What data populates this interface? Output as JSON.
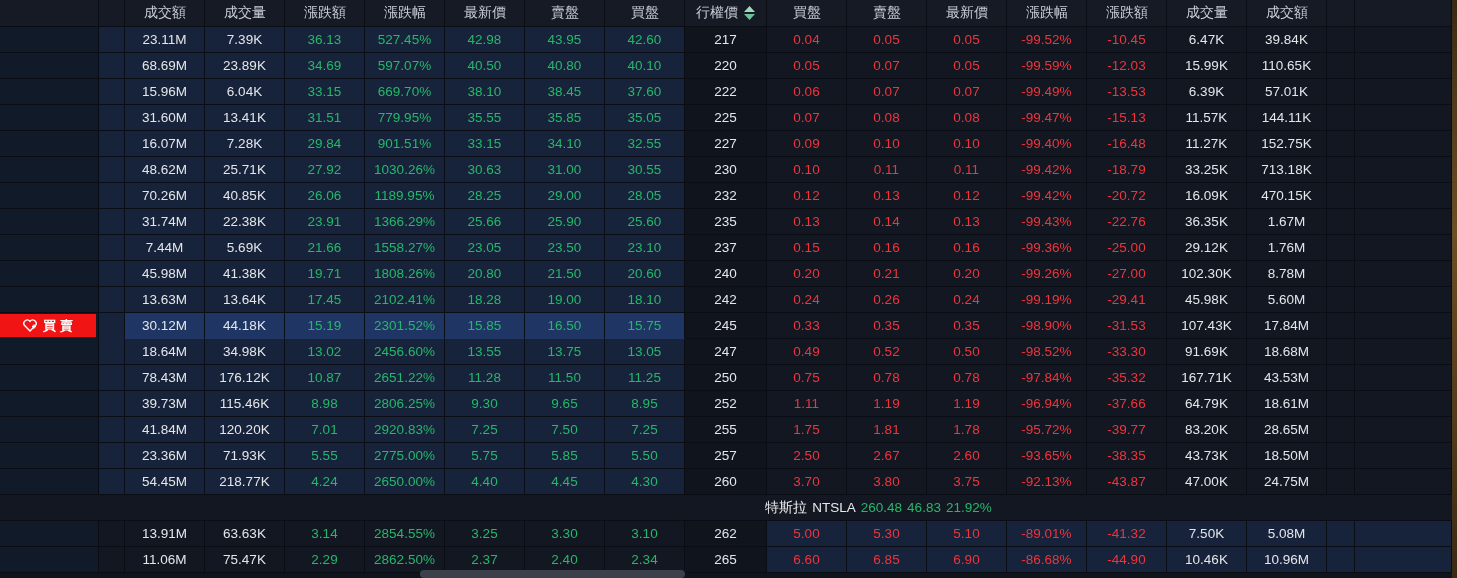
{
  "call_columns": [
    {
      "label": "成交額",
      "kind": "plain"
    },
    {
      "label": "成交量",
      "kind": "plain"
    },
    {
      "label": "漲跌額",
      "kind": "rise"
    },
    {
      "label": "漲跌幅",
      "kind": "rise"
    },
    {
      "label": "最新價",
      "kind": "rise"
    },
    {
      "label": "賣盤",
      "kind": "rise"
    },
    {
      "label": "買盤",
      "kind": "rise"
    }
  ],
  "strike_column": {
    "label": "行權價",
    "sorted": true
  },
  "put_columns": [
    {
      "label": "買盤",
      "kind": "fall"
    },
    {
      "label": "賣盤",
      "kind": "fall"
    },
    {
      "label": "最新價",
      "kind": "fall"
    },
    {
      "label": "漲跌幅",
      "kind": "fall"
    },
    {
      "label": "漲跌額",
      "kind": "fall"
    },
    {
      "label": "成交量",
      "kind": "plain"
    },
    {
      "label": "成交額",
      "kind": "plain"
    }
  ],
  "rows": [
    {
      "strike": "217",
      "selected": false,
      "call_itm": true,
      "put_itm": false,
      "call": [
        "23.11M",
        "7.39K",
        "36.13",
        "527.45%",
        "42.98",
        "43.95",
        "42.60"
      ],
      "put": [
        "0.04",
        "0.05",
        "0.05",
        "-99.52%",
        "-10.45",
        "6.47K",
        "39.84K"
      ]
    },
    {
      "strike": "220",
      "selected": false,
      "call_itm": true,
      "put_itm": false,
      "call": [
        "68.69M",
        "23.89K",
        "34.69",
        "597.07%",
        "40.50",
        "40.80",
        "40.10"
      ],
      "put": [
        "0.05",
        "0.07",
        "0.05",
        "-99.59%",
        "-12.03",
        "15.99K",
        "110.65K"
      ]
    },
    {
      "strike": "222",
      "selected": false,
      "call_itm": true,
      "put_itm": false,
      "call": [
        "15.96M",
        "6.04K",
        "33.15",
        "669.70%",
        "38.10",
        "38.45",
        "37.60"
      ],
      "put": [
        "0.06",
        "0.07",
        "0.07",
        "-99.49%",
        "-13.53",
        "6.39K",
        "57.01K"
      ]
    },
    {
      "strike": "225",
      "selected": false,
      "call_itm": true,
      "put_itm": false,
      "call": [
        "31.60M",
        "13.41K",
        "31.51",
        "779.95%",
        "35.55",
        "35.85",
        "35.05"
      ],
      "put": [
        "0.07",
        "0.08",
        "0.08",
        "-99.47%",
        "-15.13",
        "11.57K",
        "144.11K"
      ]
    },
    {
      "strike": "227",
      "selected": false,
      "call_itm": true,
      "put_itm": false,
      "call": [
        "16.07M",
        "7.28K",
        "29.84",
        "901.51%",
        "33.15",
        "34.10",
        "32.55"
      ],
      "put": [
        "0.09",
        "0.10",
        "0.10",
        "-99.40%",
        "-16.48",
        "11.27K",
        "152.75K"
      ]
    },
    {
      "strike": "230",
      "selected": false,
      "call_itm": true,
      "put_itm": false,
      "call": [
        "48.62M",
        "25.71K",
        "27.92",
        "1030.26%",
        "30.63",
        "31.00",
        "30.55"
      ],
      "put": [
        "0.10",
        "0.11",
        "0.11",
        "-99.42%",
        "-18.79",
        "33.25K",
        "713.18K"
      ]
    },
    {
      "strike": "232",
      "selected": false,
      "call_itm": true,
      "put_itm": false,
      "call": [
        "70.26M",
        "40.85K",
        "26.06",
        "1189.95%",
        "28.25",
        "29.00",
        "28.05"
      ],
      "put": [
        "0.12",
        "0.13",
        "0.12",
        "-99.42%",
        "-20.72",
        "16.09K",
        "470.15K"
      ]
    },
    {
      "strike": "235",
      "selected": false,
      "call_itm": true,
      "put_itm": false,
      "call": [
        "31.74M",
        "22.38K",
        "23.91",
        "1366.29%",
        "25.66",
        "25.90",
        "25.60"
      ],
      "put": [
        "0.13",
        "0.14",
        "0.13",
        "-99.43%",
        "-22.76",
        "36.35K",
        "1.67M"
      ]
    },
    {
      "strike": "237",
      "selected": false,
      "call_itm": true,
      "put_itm": false,
      "call": [
        "7.44M",
        "5.69K",
        "21.66",
        "1558.27%",
        "23.05",
        "23.50",
        "23.10"
      ],
      "put": [
        "0.15",
        "0.16",
        "0.16",
        "-99.36%",
        "-25.00",
        "29.12K",
        "1.76M"
      ]
    },
    {
      "strike": "240",
      "selected": false,
      "call_itm": true,
      "put_itm": false,
      "call": [
        "45.98M",
        "41.38K",
        "19.71",
        "1808.26%",
        "20.80",
        "21.50",
        "20.60"
      ],
      "put": [
        "0.20",
        "0.21",
        "0.20",
        "-99.26%",
        "-27.00",
        "102.30K",
        "8.78M"
      ]
    },
    {
      "strike": "242",
      "selected": false,
      "call_itm": true,
      "put_itm": false,
      "call": [
        "13.63M",
        "13.64K",
        "17.45",
        "2102.41%",
        "18.28",
        "19.00",
        "18.10"
      ],
      "put": [
        "0.24",
        "0.26",
        "0.24",
        "-99.19%",
        "-29.41",
        "45.98K",
        "5.60M"
      ]
    },
    {
      "strike": "245",
      "selected": true,
      "trade_button": "買 賣",
      "call_itm": true,
      "put_itm": false,
      "call": [
        "30.12M",
        "44.18K",
        "15.19",
        "2301.52%",
        "15.85",
        "16.50",
        "15.75"
      ],
      "put": [
        "0.33",
        "0.35",
        "0.35",
        "-98.90%",
        "-31.53",
        "107.43K",
        "17.84M"
      ]
    },
    {
      "strike": "247",
      "selected": false,
      "call_itm": true,
      "put_itm": false,
      "call": [
        "18.64M",
        "34.98K",
        "13.02",
        "2456.60%",
        "13.55",
        "13.75",
        "13.05"
      ],
      "put": [
        "0.49",
        "0.52",
        "0.50",
        "-98.52%",
        "-33.30",
        "91.69K",
        "18.68M"
      ]
    },
    {
      "strike": "250",
      "selected": false,
      "call_itm": true,
      "put_itm": false,
      "call": [
        "78.43M",
        "176.12K",
        "10.87",
        "2651.22%",
        "11.28",
        "11.50",
        "11.25"
      ],
      "put": [
        "0.75",
        "0.78",
        "0.78",
        "-97.84%",
        "-35.32",
        "167.71K",
        "43.53M"
      ]
    },
    {
      "strike": "252",
      "selected": false,
      "call_itm": true,
      "put_itm": false,
      "call": [
        "39.73M",
        "115.46K",
        "8.98",
        "2806.25%",
        "9.30",
        "9.65",
        "8.95"
      ],
      "put": [
        "1.11",
        "1.19",
        "1.19",
        "-96.94%",
        "-37.66",
        "64.79K",
        "18.61M"
      ]
    },
    {
      "strike": "255",
      "selected": false,
      "call_itm": true,
      "put_itm": false,
      "call": [
        "41.84M",
        "120.20K",
        "7.01",
        "2920.83%",
        "7.25",
        "7.50",
        "7.25"
      ],
      "put": [
        "1.75",
        "1.81",
        "1.78",
        "-95.72%",
        "-39.77",
        "83.20K",
        "28.65M"
      ]
    },
    {
      "strike": "257",
      "selected": false,
      "call_itm": true,
      "put_itm": false,
      "call": [
        "23.36M",
        "71.93K",
        "5.55",
        "2775.00%",
        "5.75",
        "5.85",
        "5.50"
      ],
      "put": [
        "2.50",
        "2.67",
        "2.60",
        "-93.65%",
        "-38.35",
        "43.73K",
        "18.50M"
      ]
    },
    {
      "strike": "260",
      "selected": false,
      "call_itm": true,
      "put_itm": false,
      "call": [
        "54.45M",
        "218.77K",
        "4.24",
        "2650.00%",
        "4.40",
        "4.45",
        "4.30"
      ],
      "put": [
        "3.70",
        "3.80",
        "3.75",
        "-92.13%",
        "-43.87",
        "47.00K",
        "24.75M"
      ]
    }
  ],
  "underlying": {
    "name": "特斯拉",
    "symbol": "NTSLA",
    "price": "260.48",
    "change": "46.83",
    "percent": "21.92%",
    "kind": "rise"
  },
  "rows_below": [
    {
      "strike": "262",
      "selected": false,
      "call_itm": false,
      "put_itm": true,
      "call": [
        "13.91M",
        "63.63K",
        "3.14",
        "2854.55%",
        "3.25",
        "3.30",
        "3.10"
      ],
      "put": [
        "5.00",
        "5.30",
        "5.10",
        "-89.01%",
        "-41.32",
        "7.50K",
        "5.08M"
      ]
    },
    {
      "strike": "265",
      "selected": false,
      "call_itm": false,
      "put_itm": true,
      "call": [
        "11.06M",
        "75.47K",
        "2.29",
        "2862.50%",
        "2.37",
        "2.40",
        "2.34"
      ],
      "put": [
        "6.60",
        "6.85",
        "6.90",
        "-86.68%",
        "-44.90",
        "10.46K",
        "10.96M"
      ]
    }
  ]
}
